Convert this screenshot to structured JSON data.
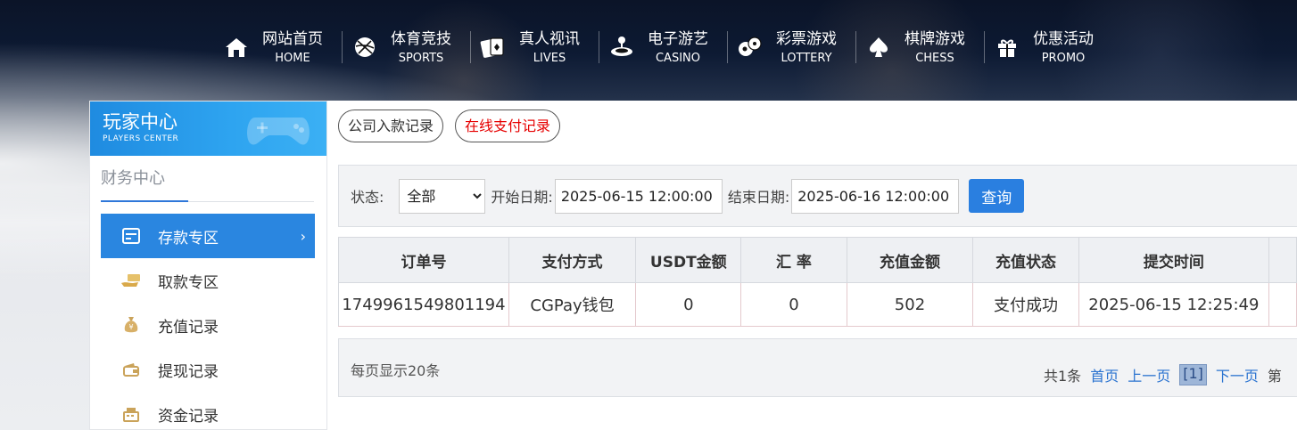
{
  "nav": [
    {
      "cn": "网站首页",
      "en": "HOME",
      "icon": "home-icon"
    },
    {
      "cn": "体育竞技",
      "en": "SPORTS",
      "icon": "basketball-icon"
    },
    {
      "cn": "真人视讯",
      "en": "LIVES",
      "icon": "playing-cards-icon"
    },
    {
      "cn": "电子游艺",
      "en": "CASINO",
      "icon": "joystick-icon"
    },
    {
      "cn": "彩票游戏",
      "en": "LOTTERY",
      "icon": "lottery-balls-icon"
    },
    {
      "cn": "棋牌游戏",
      "en": "CHESS",
      "icon": "spade-icon"
    },
    {
      "cn": "优惠活动",
      "en": "PROMO",
      "icon": "gift-icon"
    }
  ],
  "sidebar": {
    "title": "玩家中心",
    "subtitle": "PLAYERS CENTER",
    "section": "财务中心",
    "items": [
      {
        "label": "存款专区",
        "icon": "card-icon",
        "active": true
      },
      {
        "label": "取款专区",
        "icon": "cash-hand-icon"
      },
      {
        "label": "充值记录",
        "icon": "money-bag-icon"
      },
      {
        "label": "提现记录",
        "icon": "wallet-icon"
      },
      {
        "label": "资金记录",
        "icon": "cash-register-icon"
      }
    ]
  },
  "tabs": [
    {
      "label": "公司入款记录",
      "active": false
    },
    {
      "label": "在线支付记录",
      "active": true
    }
  ],
  "filter": {
    "status_label": "状态:",
    "status_value": "全部",
    "start_label": "开始日期:",
    "start_value": "2025-06-15 12:00:00",
    "end_label": "结束日期:",
    "end_value": "2025-06-16 12:00:00",
    "query_label": "查询"
  },
  "table": {
    "headers": [
      "订单号",
      "支付方式",
      "USDT金额",
      "汇 率",
      "充值金额",
      "充值状态",
      "提交时间"
    ],
    "rows": [
      [
        "1749961549801194",
        "CGPay钱包",
        "0",
        "0",
        "502",
        "支付成功",
        "2025-06-15 12:25:49"
      ]
    ]
  },
  "pager": {
    "per_page": "每页显示20条",
    "total": "共1条",
    "first": "首页",
    "prev": "上一页",
    "current": "[1]",
    "next": "下一页",
    "tail": "第"
  }
}
